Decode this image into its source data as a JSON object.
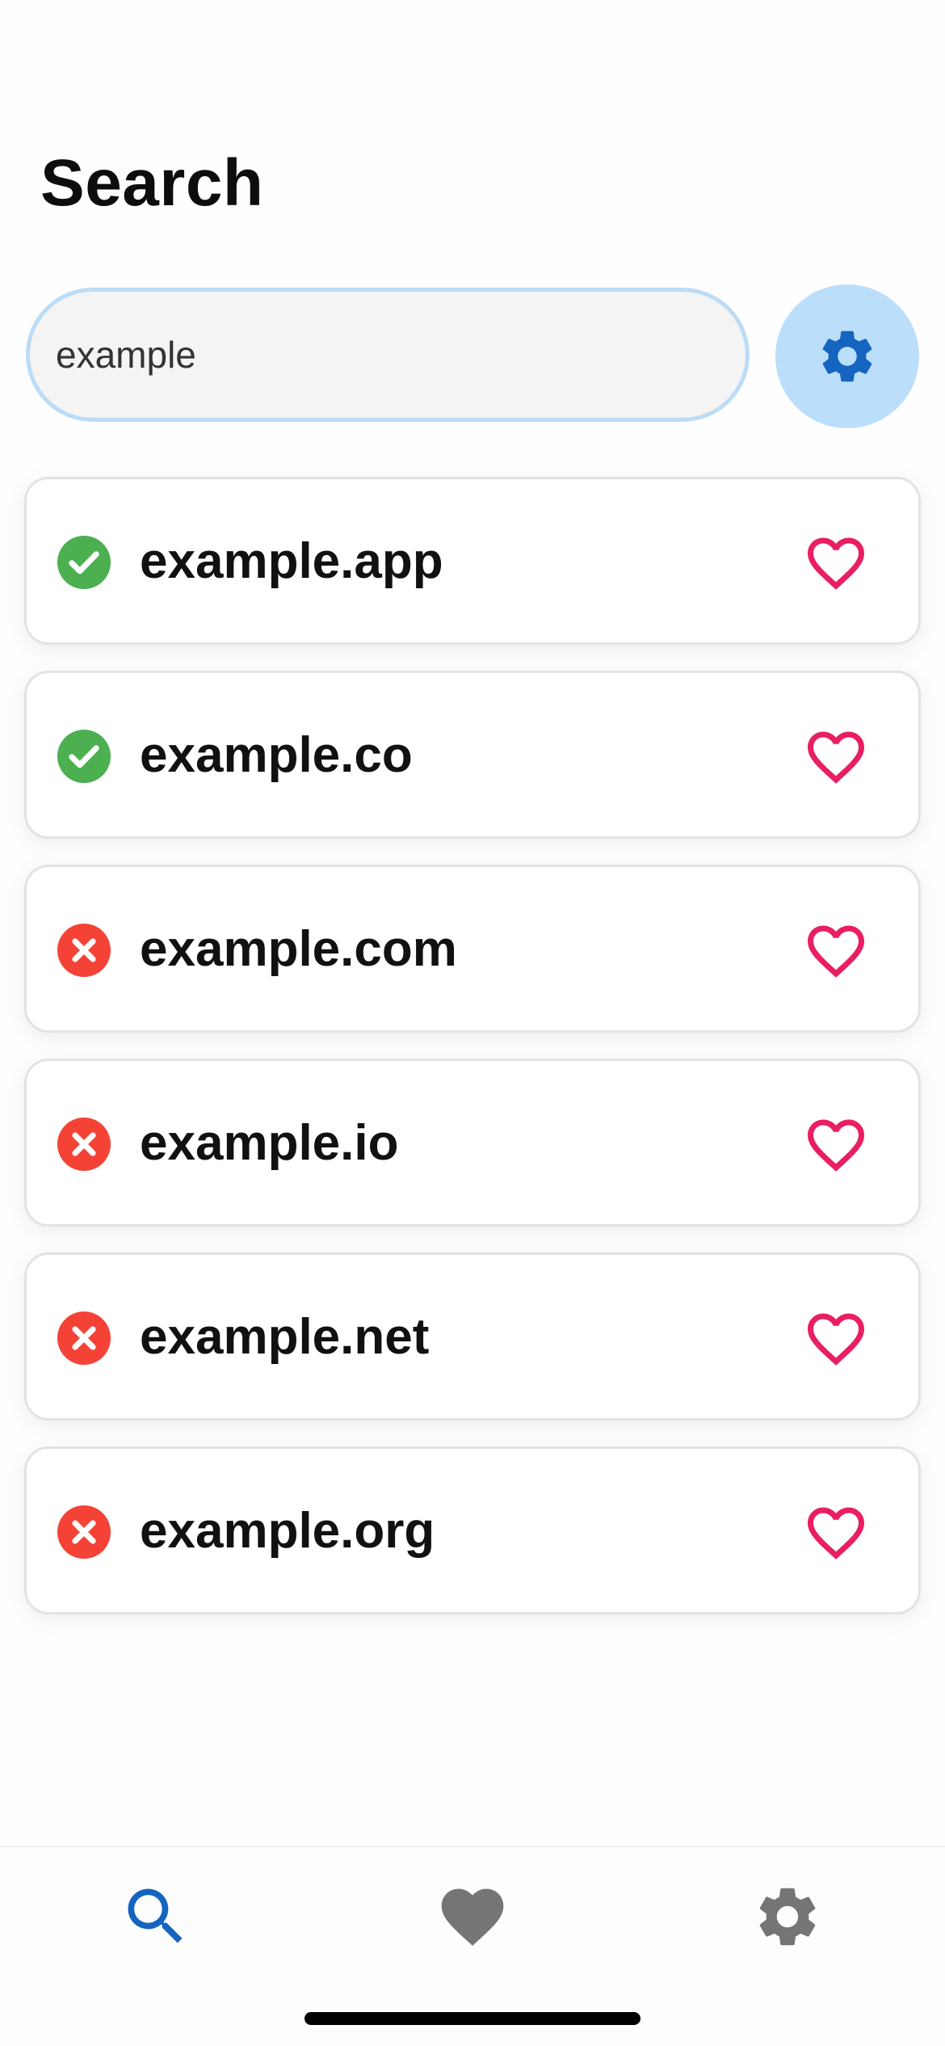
{
  "header": {
    "title": "Search"
  },
  "search": {
    "value": "example",
    "settings_icon": "gear-icon"
  },
  "colors": {
    "available": "#4caf50",
    "taken": "#f44336",
    "favorite": "#e91e63",
    "accent": "#1565c0",
    "nav_inactive": "#757575"
  },
  "results": [
    {
      "domain": "example.app",
      "status": "available",
      "status_icon": "check-circle-icon",
      "favorite_icon": "heart-outline-icon"
    },
    {
      "domain": "example.co",
      "status": "available",
      "status_icon": "check-circle-icon",
      "favorite_icon": "heart-outline-icon"
    },
    {
      "domain": "example.com",
      "status": "taken",
      "status_icon": "x-circle-icon",
      "favorite_icon": "heart-outline-icon"
    },
    {
      "domain": "example.io",
      "status": "taken",
      "status_icon": "x-circle-icon",
      "favorite_icon": "heart-outline-icon"
    },
    {
      "domain": "example.net",
      "status": "taken",
      "status_icon": "x-circle-icon",
      "favorite_icon": "heart-outline-icon"
    },
    {
      "domain": "example.org",
      "status": "taken",
      "status_icon": "x-circle-icon",
      "favorite_icon": "heart-outline-icon"
    }
  ],
  "bottom_nav": {
    "items": [
      {
        "icon": "search-icon",
        "active": true
      },
      {
        "icon": "heart-icon",
        "active": false
      },
      {
        "icon": "gear-icon",
        "active": false
      }
    ]
  }
}
